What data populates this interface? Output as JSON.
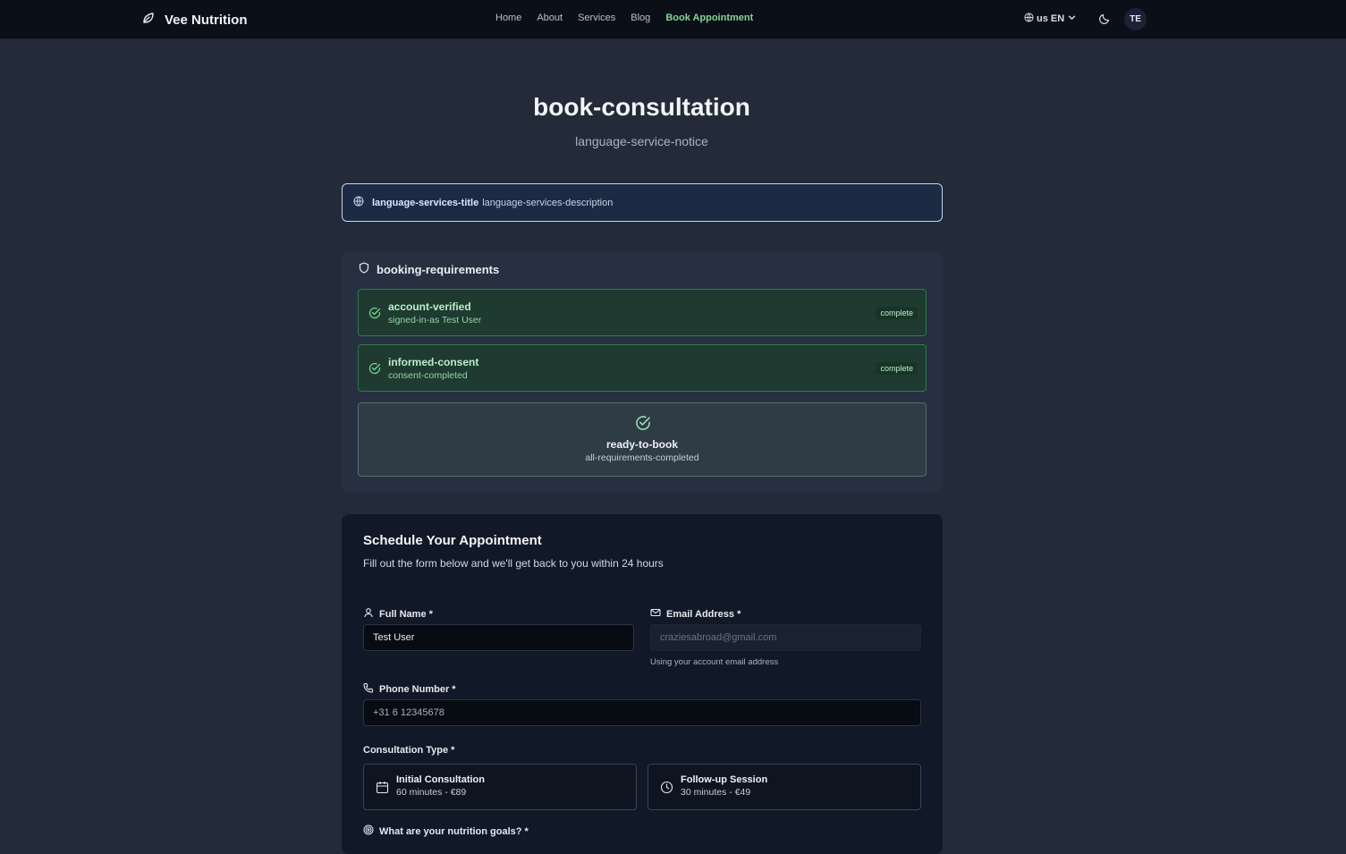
{
  "nav": {
    "brand": "Vee Nutrition",
    "links": [
      "Home",
      "About",
      "Services",
      "Blog",
      "Book Appointment"
    ],
    "active_link": "Book Appointment",
    "language_label": "us EN",
    "avatar_initials": "TE"
  },
  "header": {
    "title": "book-consultation",
    "subtitle": "language-service-notice"
  },
  "language_notice": {
    "title": "language-services-title",
    "description": "language-services-description"
  },
  "requirements": {
    "title": "booking-requirements",
    "items": [
      {
        "title": "account-verified",
        "subtitle": "signed-in-as Test User",
        "status": "complete"
      },
      {
        "title": "informed-consent",
        "subtitle": "consent-completed",
        "status": "complete"
      }
    ],
    "ready": {
      "title": "ready-to-book",
      "subtitle": "all-requirements-completed"
    }
  },
  "form": {
    "title": "Schedule Your Appointment",
    "description": "Fill out the form below and we'll get back to you within 24 hours",
    "full_name": {
      "label": "Full Name *",
      "value": "Test User"
    },
    "email": {
      "label": "Email Address *",
      "value": "craziesabroad@gmail.com",
      "help": "Using your account email address"
    },
    "phone": {
      "label": "Phone Number *",
      "placeholder": "+31 6 12345678"
    },
    "consultation_type": {
      "label": "Consultation Type *",
      "options": [
        {
          "title": "Initial Consultation",
          "subtitle": "60 minutes - €89"
        },
        {
          "title": "Follow-up Session",
          "subtitle": "30 minutes - €49"
        }
      ]
    },
    "goals": {
      "label": "What are your nutrition goals? *"
    }
  },
  "colors": {
    "accent": "#86d49a",
    "complete_border": "#2e7a4c",
    "page_bg": "#232b38"
  }
}
